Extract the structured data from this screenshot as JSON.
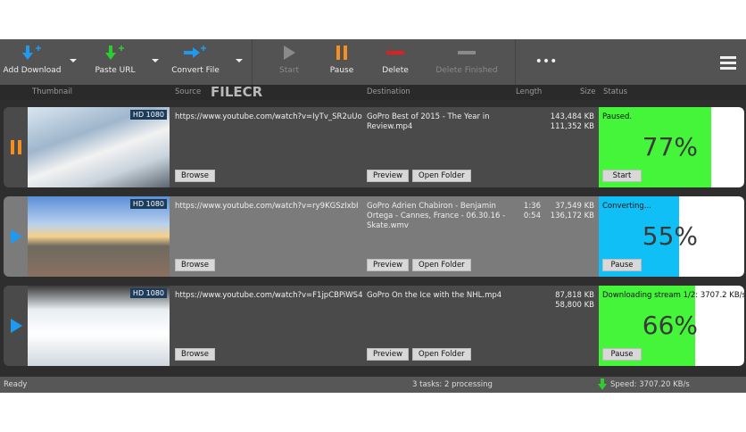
{
  "toolbar": {
    "add_download": "Add Download",
    "paste_url": "Paste URL",
    "convert_file": "Convert File",
    "start": "Start",
    "pause": "Pause",
    "delete": "Delete",
    "delete_finished": "Delete Finished",
    "more": "•••"
  },
  "columns": {
    "thumbnail": "Thumbnail",
    "source": "Source",
    "destination": "Destination",
    "length": "Length",
    "size": "Size",
    "status": "Status"
  },
  "watermark": "FILECR",
  "tasks": [
    {
      "state": "paused",
      "quality": "HD 1080",
      "source": "https://www.youtube.com/watch?v=IyTv_SR2uUo",
      "destination": "GoPro  Best of 2015 - The Year in Review.mp4",
      "length1": "",
      "length2": "",
      "size1": "143,484 KB",
      "size2": "111,352 KB",
      "browse": "Browse",
      "preview": "Preview",
      "open_folder": "Open Folder",
      "status_text": "Paused.",
      "percent": "77%",
      "progress": 77,
      "action": "Start",
      "color": "#44f53a"
    },
    {
      "state": "converting",
      "quality": "HD 1080",
      "source": "https://www.youtube.com/watch?v=ry9KGSzIxbI",
      "destination": "GoPro  Adrien Chabiron - Benjamin Ortega - Cannes, France - 06.30.16 - Skate.wmv",
      "length1": "1:36",
      "length2": "0:54",
      "size1": "37,549 KB",
      "size2": "136,172 KB",
      "browse": "Browse",
      "preview": "Preview",
      "open_folder": "Open Folder",
      "status_text": "Converting...",
      "percent": "55%",
      "progress": 55,
      "action": "Pause",
      "color": "#0fbff5"
    },
    {
      "state": "downloading",
      "quality": "HD 1080",
      "source": "https://www.youtube.com/watch?v=F1jpCBPiWS4",
      "destination": "GoPro  On the Ice with the NHL.mp4",
      "length1": "",
      "length2": "",
      "size1": "87,818 KB",
      "size2": "58,800 KB",
      "browse": "Browse",
      "preview": "Preview",
      "open_folder": "Open Folder",
      "status_text": "Downloading stream 1/2: 3707.2 KB/s",
      "percent": "66%",
      "progress": 66,
      "action": "Pause",
      "color": "#44f53a"
    }
  ],
  "statusbar": {
    "ready": "Ready",
    "tasks": "3 tasks: 2 processing",
    "speed": "Speed: 3707.20 KB/s"
  }
}
